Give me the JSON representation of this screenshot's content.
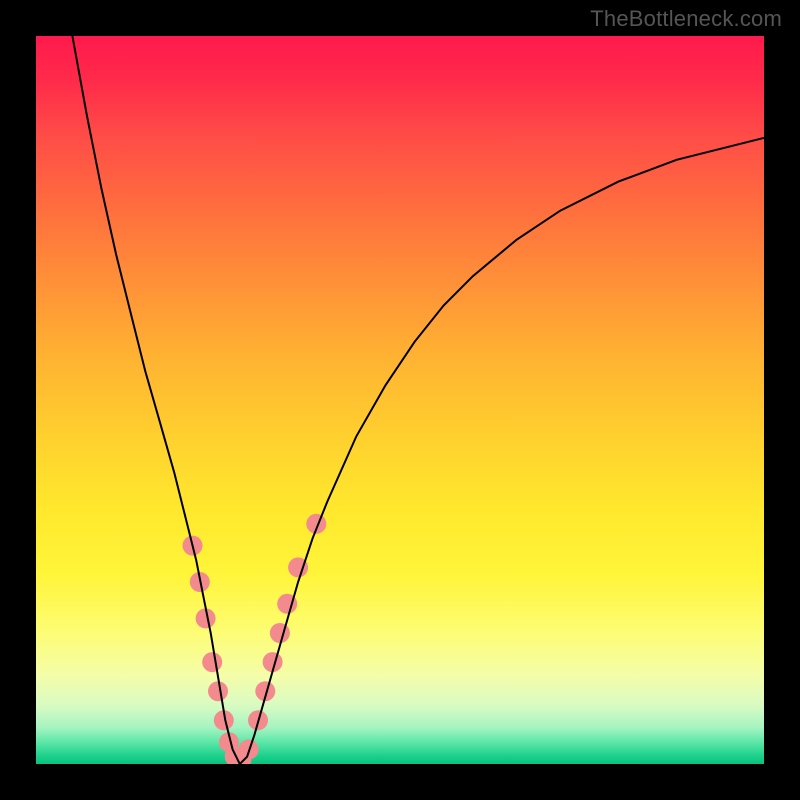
{
  "attribution": "TheBottleneck.com",
  "chart_data": {
    "type": "line",
    "title": "",
    "xlabel": "",
    "ylabel": "",
    "xlim": [
      0,
      100
    ],
    "ylim": [
      0,
      100
    ],
    "grid": false,
    "legend": false,
    "background": {
      "gradient_stops": [
        {
          "pos": 0,
          "color": "#ff1a4d"
        },
        {
          "pos": 14,
          "color": "#ff4d47"
        },
        {
          "pos": 34,
          "color": "#ff9138"
        },
        {
          "pos": 55,
          "color": "#ffd02e"
        },
        {
          "pos": 74,
          "color": "#fff53a"
        },
        {
          "pos": 88,
          "color": "#f4fdaa"
        },
        {
          "pos": 97,
          "color": "#5de7a8"
        },
        {
          "pos": 100,
          "color": "#0ac27f"
        }
      ],
      "note": "Vertical gradient from red at top through orange and yellow to green at the very bottom."
    },
    "series": [
      {
        "name": "bottleneck-curve",
        "color": "#000000",
        "stroke_width": 2,
        "x": [
          5,
          7,
          9,
          11,
          13,
          15,
          17,
          19,
          21,
          22,
          23,
          24,
          25,
          26,
          27,
          28,
          29,
          30,
          32,
          34,
          36,
          38,
          40,
          44,
          48,
          52,
          56,
          60,
          66,
          72,
          80,
          88,
          96,
          100
        ],
        "y": [
          100,
          89,
          79,
          70,
          62,
          54,
          47,
          40,
          32,
          28,
          23,
          18,
          12,
          6,
          2,
          0,
          1,
          4,
          11,
          18,
          25,
          31,
          36,
          45,
          52,
          58,
          63,
          67,
          72,
          76,
          80,
          83,
          85,
          86
        ]
      }
    ],
    "markers": [
      {
        "name": "highlight-points",
        "color": "#f38b8e",
        "radius": 10,
        "points": [
          {
            "x": 21.5,
            "y": 30
          },
          {
            "x": 22.5,
            "y": 25
          },
          {
            "x": 23.3,
            "y": 20
          },
          {
            "x": 24.2,
            "y": 14
          },
          {
            "x": 25.0,
            "y": 10
          },
          {
            "x": 25.8,
            "y": 6
          },
          {
            "x": 26.5,
            "y": 3
          },
          {
            "x": 27.3,
            "y": 1
          },
          {
            "x": 28.2,
            "y": 0.5
          },
          {
            "x": 29.2,
            "y": 2
          },
          {
            "x": 30.5,
            "y": 6
          },
          {
            "x": 31.5,
            "y": 10
          },
          {
            "x": 32.5,
            "y": 14
          },
          {
            "x": 33.5,
            "y": 18
          },
          {
            "x": 34.5,
            "y": 22
          },
          {
            "x": 36.0,
            "y": 27
          },
          {
            "x": 38.5,
            "y": 33
          }
        ]
      }
    ]
  }
}
